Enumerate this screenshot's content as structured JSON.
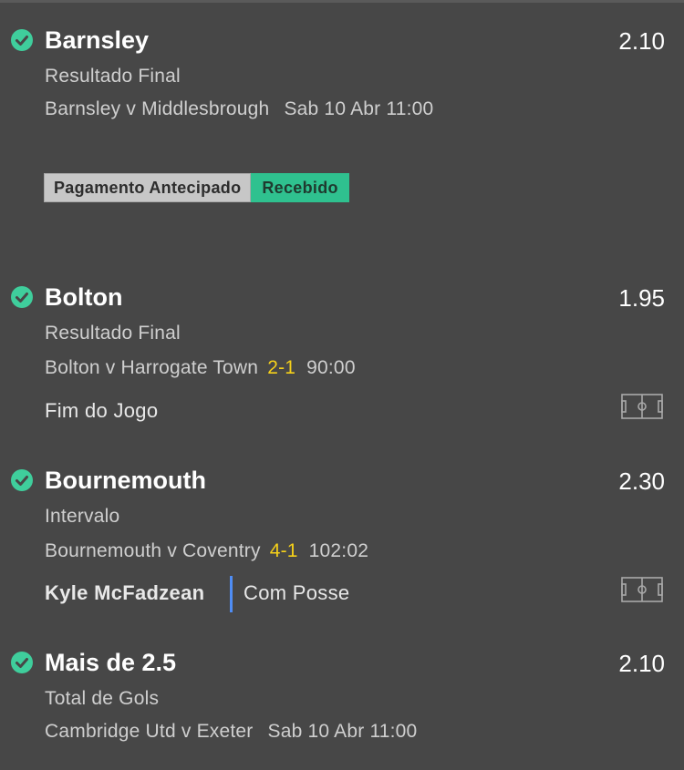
{
  "bets": [
    {
      "selection": "Barnsley",
      "odds": "2.10",
      "market": "Resultado Final",
      "event": "Barnsley v Middlesbrough",
      "date": "Sab 10 Abr 11:00",
      "badge": {
        "left": "Pagamento Antecipado",
        "right": "Recebido"
      }
    },
    {
      "selection": "Bolton",
      "odds": "1.95",
      "market": "Resultado Final",
      "event": "Bolton v Harrogate Town",
      "score": "2-1",
      "time": "90:00",
      "status": "Fim do Jogo"
    },
    {
      "selection": "Bournemouth",
      "odds": "2.30",
      "market": "Intervalo",
      "event": "Bournemouth v Coventry",
      "score": "4-1",
      "time": "102:02",
      "player": "Kyle McFadzean",
      "possession": "Com Posse"
    },
    {
      "selection": "Mais de 2.5",
      "odds": "2.10",
      "market": "Total de Gols",
      "event": "Cambridge Utd v Exeter",
      "date": "Sab 10 Abr 11:00"
    }
  ],
  "colors": {
    "background": "#474747",
    "check": "#3fce9c",
    "score": "#f5d01a",
    "received_badge": "#2fc18f",
    "possession_bar": "#4f8df5"
  },
  "icons": {
    "check": "check-circle-icon",
    "pitch": "pitch-icon"
  }
}
